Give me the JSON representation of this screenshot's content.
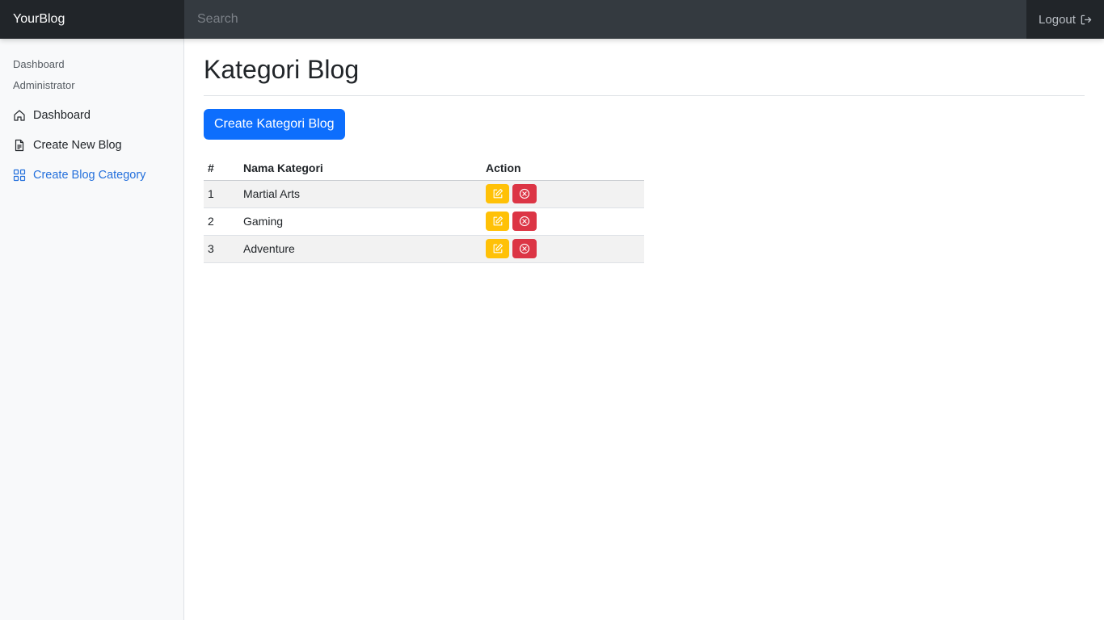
{
  "navbar": {
    "brand": "YourBlog",
    "search_placeholder": "Search",
    "logout_label": "Logout"
  },
  "sidebar": {
    "headings": [
      "Dashboard",
      "Administrator"
    ],
    "items": [
      {
        "label": "Dashboard",
        "icon": "home-icon",
        "active": false
      },
      {
        "label": "Create New Blog",
        "icon": "file-text-icon",
        "active": false
      },
      {
        "label": "Create Blog Category",
        "icon": "grid-icon",
        "active": true
      }
    ]
  },
  "main": {
    "title": "Kategori Blog",
    "create_button": "Create Kategori Blog",
    "table": {
      "headers": [
        "#",
        "Nama Kategori",
        "Action"
      ],
      "rows": [
        {
          "num": "1",
          "name": "Martial Arts"
        },
        {
          "num": "2",
          "name": "Gaming"
        },
        {
          "num": "3",
          "name": "Adventure"
        }
      ]
    }
  },
  "colors": {
    "navbar": "#343a40",
    "brand_bg": "#212529",
    "primary": "#0d6efd",
    "sidebar_active": "#2470dc",
    "edit_button": "#ffc107",
    "delete_button": "#dc3545"
  }
}
